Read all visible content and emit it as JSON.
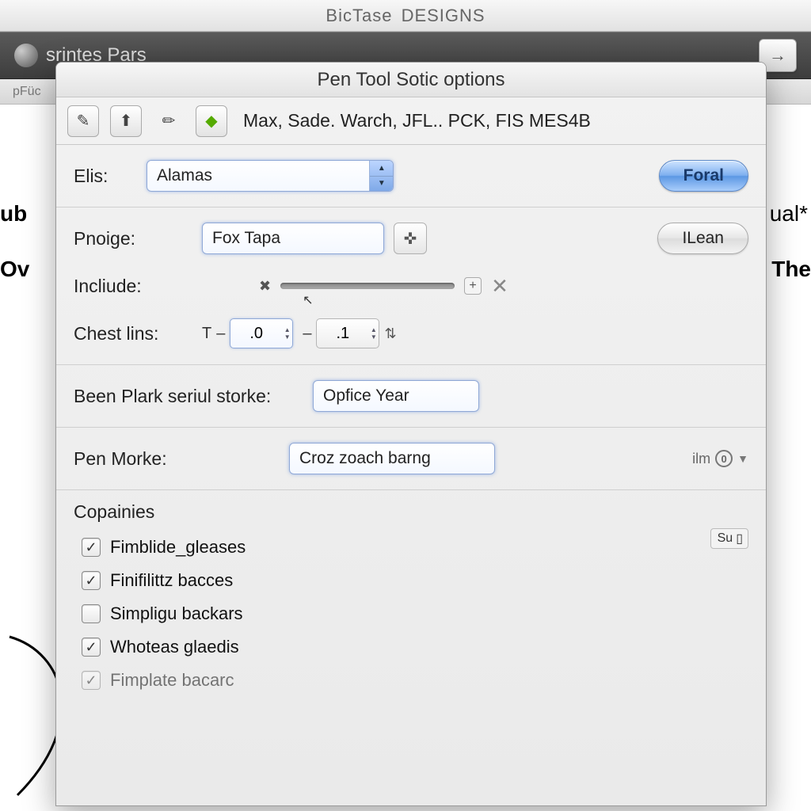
{
  "app": {
    "title_a": "BicTase",
    "title_b": "DESIGNS"
  },
  "main_toolbar": {
    "text": "srintes  Pars",
    "forward_icon": "→"
  },
  "sub_bar": {
    "text": "pFüc"
  },
  "background": {
    "left_text_1": "ub",
    "left_text_2": "Ov",
    "right_text_1": "ual*",
    "right_text_2": "The"
  },
  "dialog": {
    "title": "Pen Tool Sotic options",
    "toolbar_text": "Max, Sade. Warch,  JFL..  PCK, FIS MES4B",
    "elis": {
      "label": "Elis:",
      "value": "Alamas",
      "button": "Foral"
    },
    "pnoige": {
      "label": "Pnoige:",
      "value": "Fox Tapa",
      "button": "ILean"
    },
    "include": {
      "label": "Incliude:",
      "end_plus": "+"
    },
    "chest": {
      "label": "Chest lins:",
      "prefix": "T",
      "val_a": ".0",
      "val_b": ".1"
    },
    "been": {
      "label": "Been Plark seriul storke:",
      "value": "Opfice Year"
    },
    "pen_morke": {
      "label": "Pen Morke:",
      "value": "Croz zoach barng",
      "ilm_label": "ilm",
      "ilm_value": "0"
    },
    "copainies": {
      "title": "Copainies",
      "items": [
        {
          "label": "Fimblide_gleases",
          "checked": true
        },
        {
          "label": "Finifilittz bacces",
          "checked": true
        },
        {
          "label": "Simpligu backars",
          "checked": false
        },
        {
          "label": "Whoteas glaedis",
          "checked": true
        },
        {
          "label": "Fimplate bacarc",
          "checked": true
        }
      ],
      "su_label": "Su"
    }
  }
}
